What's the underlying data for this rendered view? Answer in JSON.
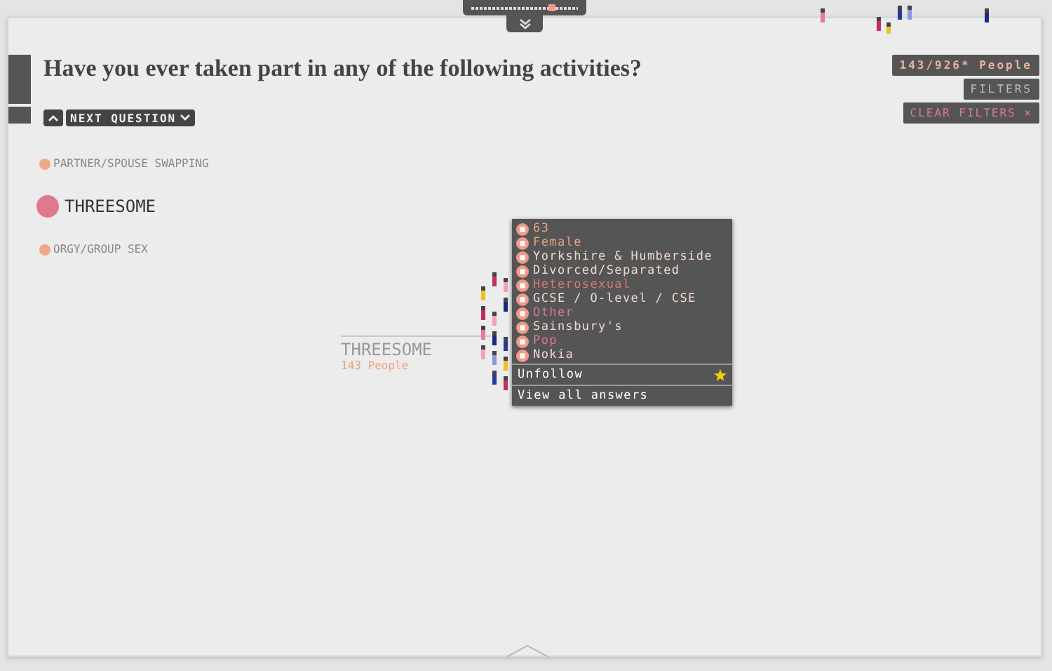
{
  "progress": {
    "level": 0.79
  },
  "question": {
    "title": "Have you ever taken part in any of the following activities?",
    "next_label": "NEXT QUESTION"
  },
  "controls": {
    "people_count": "143/926* People",
    "filters": "FILTERS",
    "clear_filters": "CLEAR FILTERS ×"
  },
  "answers": [
    {
      "label": "PARTNER/SPOUSE SWAPPING",
      "selected": false
    },
    {
      "label": "THREESOME",
      "selected": true
    },
    {
      "label": "ORGY/GROUP SEX",
      "selected": false
    }
  ],
  "group": {
    "label": "THREESOME",
    "count": "143 People"
  },
  "profile": {
    "items": [
      {
        "text": "63",
        "color": "#f0a080"
      },
      {
        "text": "Female",
        "color": "#f0a080"
      },
      {
        "text": "Yorkshire & Humberside",
        "color": "#f0d8d0"
      },
      {
        "text": "Divorced/Separated",
        "color": "#f0d8d0"
      },
      {
        "text": "Heterosexual",
        "color": "#d87878"
      },
      {
        "text": "GCSE / O-level / CSE",
        "color": "#f0d8d0"
      },
      {
        "text": "Other",
        "color": "#e07890"
      },
      {
        "text": "Sainsbury's",
        "color": "#f0d8d0"
      },
      {
        "text": "Pop",
        "color": "#e07890"
      },
      {
        "text": "Nokia",
        "color": "#f0d8d0"
      }
    ],
    "unfollow": "Unfollow",
    "view_all": "View all answers"
  }
}
